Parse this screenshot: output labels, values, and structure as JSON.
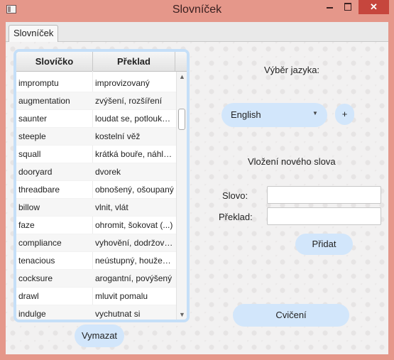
{
  "window": {
    "title": "Slovníček",
    "close_glyph": "✕"
  },
  "tabs": [
    {
      "label": "Slovníček"
    }
  ],
  "table": {
    "headers": [
      "Slovíčko",
      "Překlad"
    ],
    "rows": [
      [
        "impromptu",
        "improvizovaný"
      ],
      [
        "augmentation",
        "zvýšení, rozšíření"
      ],
      [
        "saunter",
        "loudat se, potloukat se"
      ],
      [
        "steeple",
        "kostelní věž"
      ],
      [
        "squall",
        "krátká bouře, náhlý příval"
      ],
      [
        "dooryard",
        "dvorek"
      ],
      [
        "threadbare",
        "obnošený, ošoupaný"
      ],
      [
        "billow",
        "vlnit, vlát"
      ],
      [
        "faze",
        "ohromit, šokovat (...)"
      ],
      [
        "compliance",
        "vyhovění, dodržování"
      ],
      [
        "tenacious",
        "neústupný, houževnatý"
      ],
      [
        "cocksure",
        "arogantní, povýšený"
      ],
      [
        "drawl",
        "mluvit pomalu"
      ],
      [
        "indulge",
        "vychutnat si"
      ]
    ],
    "scroll_up_glyph": "▲",
    "scroll_down_glyph": "▼"
  },
  "language": {
    "heading": "Výběr jazyka:",
    "selected": "English",
    "dropdown_glyph": "▼",
    "add_label": "+"
  },
  "new_word": {
    "heading": "Vložení nového slova",
    "word_label": "Slovo:",
    "word_value": "",
    "translation_label": "Překlad:",
    "translation_value": "",
    "add_button": "Přidat"
  },
  "buttons": {
    "practice": "Cvičení",
    "delete": "Vymazat"
  },
  "colors": {
    "titlebar": "#e5978a",
    "close": "#c6463d",
    "accent_blue": "#d2e6fb",
    "table_border": "#c5dff8"
  }
}
